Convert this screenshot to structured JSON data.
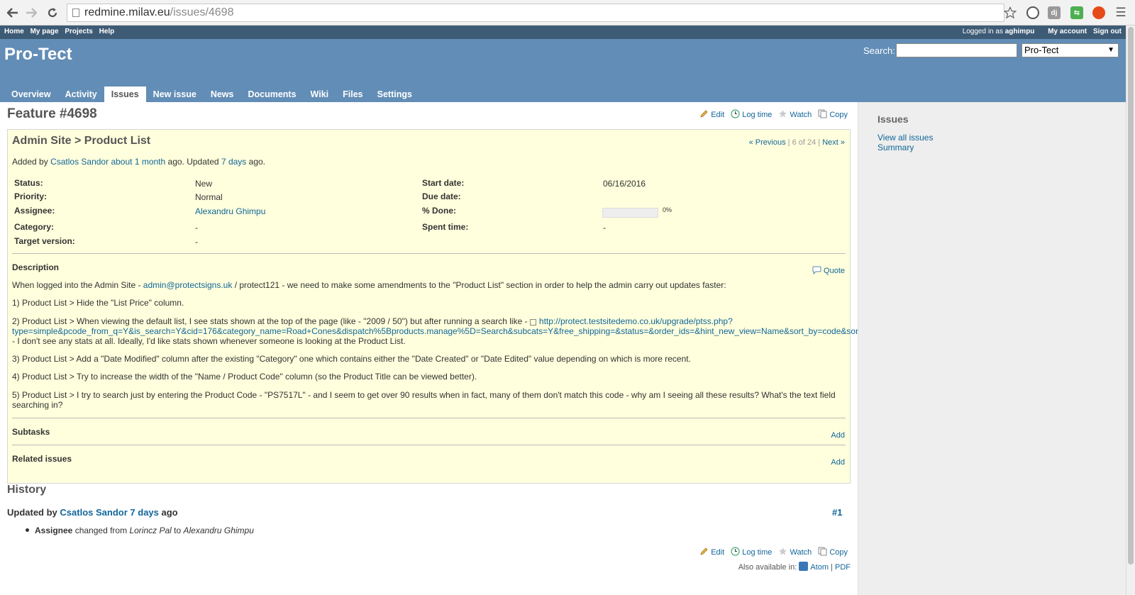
{
  "browser": {
    "url_host": "redmine.milav.eu",
    "url_path": "/issues/4698"
  },
  "top_menu": {
    "items": [
      "Home",
      "My page",
      "Projects",
      "Help"
    ],
    "logged_in_prefix": "Logged in as",
    "username": "aghimpu",
    "my_account": "My account",
    "sign_out": "Sign out"
  },
  "header": {
    "project_title": "Pro-Tect",
    "search_label": "Search:",
    "search_placeholder": "",
    "project_select": "Pro-Tect"
  },
  "main_menu": {
    "tabs": [
      "Overview",
      "Activity",
      "Issues",
      "New issue",
      "News",
      "Documents",
      "Wiki",
      "Files",
      "Settings"
    ],
    "selected": "Issues"
  },
  "actions": {
    "edit": "Edit",
    "log_time": "Log time",
    "watch": "Watch",
    "copy": "Copy"
  },
  "issue": {
    "title": "Feature #4698",
    "subject": "Admin Site > Product List",
    "nav": {
      "previous": "« Previous",
      "position": "6 of 24",
      "next": "Next »"
    },
    "author_line": {
      "added_by": "Added by",
      "author": "Csatlos Sandor",
      "created": "about 1 month",
      "ago_updated": "ago. Updated",
      "updated": "7 days",
      "ago": "ago."
    },
    "attributes": {
      "status_label": "Status:",
      "status": "New",
      "priority_label": "Priority:",
      "priority": "Normal",
      "assignee_label": "Assignee:",
      "assignee": "Alexandru Ghimpu",
      "category_label": "Category:",
      "category": "-",
      "target_label": "Target version:",
      "target": "-",
      "start_label": "Start date:",
      "start": "06/16/2016",
      "due_label": "Due date:",
      "due": "",
      "done_label": "% Done:",
      "done": "0%",
      "done_fraction": 0,
      "spent_label": "Spent time:",
      "spent": "-"
    },
    "description": {
      "title": "Description",
      "quote": "Quote",
      "p1_a": "When logged into the Admin Site - ",
      "p1_email": "admin@protectsigns.uk",
      "p1_b": " / protect121 - we need to make some amendments to the \"Product List\" section in order to help the admin carry out updates faster:",
      "p2": "1) Product List > Hide the \"List Price\" column.",
      "p3_a": "2) Product List > When viewing the default list, I see stats shown at the top of the page (like - \"2009 / 50\") but after running a search like - ",
      "p3_link1": "http://protect.testsitedemo.co.uk/upgrade/ptss.php?",
      "p3_link2": "type=simple&pcode_from_q=Y&is_search=Y&cid=176&category_name=Road+Cones&dispatch%5Bproducts.manage%5D=Search&subcats=Y&free_shipping=&status=&order_ids=&hint_new_view=Name&sort_by=code&sort_order=desc",
      "p3_b": "- I don't see any stats at all. Ideally, I'd like stats shown whenever someone is looking at the Product List.",
      "p4": "3) Product List > Add a \"Date Modified\" column after the existing \"Category\" one which contains either the \"Date Created\" or \"Date Edited\" value depending on which is more recent.",
      "p5": "4) Product List > Try to increase the width of the \"Name / Product Code\" column (so the Product Title can be viewed better).",
      "p6_a": "5) Product List > I try to search just by entering the Product Code - \"PS7517L\" - and I seem to get over 90 results when in fact, many of them don't match this code - why am I seeing all these results? What's the text field",
      "p6_b": "searching in?"
    },
    "subtasks": {
      "title": "Subtasks",
      "add": "Add"
    },
    "related": {
      "title": "Related issues",
      "add": "Add"
    }
  },
  "history": {
    "title": "History",
    "updated_by": "Updated by",
    "author": "Csatlos Sandor",
    "when": "7 days",
    "ago": "ago",
    "number": "#1",
    "detail_field": "Assignee",
    "detail_changed": "changed from",
    "detail_from": "Lorincz Pal",
    "detail_to_word": "to",
    "detail_to": "Alexandru Ghimpu"
  },
  "footer": {
    "also_available": "Also available in:",
    "atom": "Atom",
    "sep": "|",
    "pdf": "PDF"
  },
  "sidebar": {
    "title": "Issues",
    "links": [
      "View all issues",
      "Summary"
    ]
  },
  "colors": {
    "top_menu": "#3e5b76",
    "header": "#628db6",
    "issue_bg": "#ffffdd",
    "link": "#116699",
    "sidebar": "#eeeeee"
  }
}
